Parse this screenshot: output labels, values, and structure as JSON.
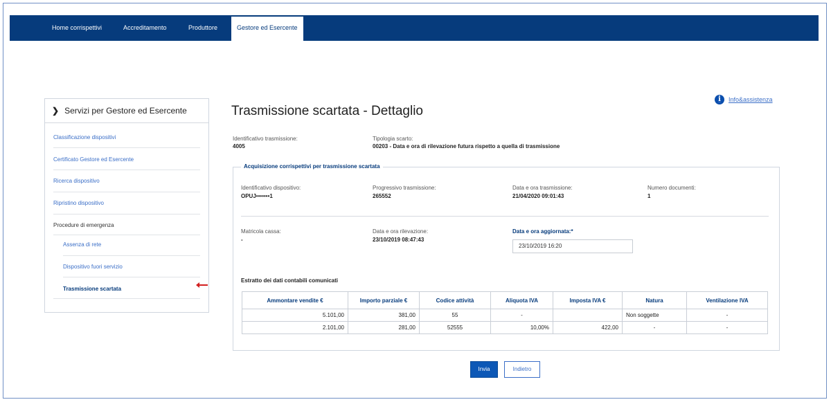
{
  "nav": {
    "items": [
      "Home corrispettivi",
      "Accreditamento",
      "Produttore",
      "Gestore ed Esercente"
    ],
    "active_index": 3
  },
  "info_link": "Info&assistenza",
  "sidebar": {
    "title": "Servizi per Gestore ed Esercente",
    "items": [
      "Classificazione dispositivi",
      "Certificato Gestore ed Esercente",
      "Ricerca dispositivo",
      "Ripristino dispositivo"
    ],
    "group_label": "Procedure di emergenza",
    "sub_items": [
      "Assenza di rete",
      "Dispositivo fuori servizio",
      "Trasmissione scartata"
    ]
  },
  "page_title": "Trasmissione scartata - Dettaglio",
  "header_fields": {
    "id_label": "Identificativo trasmissione:",
    "id_value": "4005",
    "tipo_label": "Tipologia scarto:",
    "tipo_value": "00203 - Data e ora di rilevazione futura rispetto a quella di trasmissione"
  },
  "section": {
    "legend": "Acquisizione corrispettivi per trasmissione scartata",
    "fields": [
      {
        "label": "Identificativo dispositivo:",
        "value": "OPUJ•••••••1"
      },
      {
        "label": "Progressivo trasmissione:",
        "value": "265552"
      },
      {
        "label": "Data e ora trasmissione:",
        "value": "21/04/2020 09:01:43"
      },
      {
        "label": "Numero documenti:",
        "value": "1"
      },
      {
        "label": "Matricola cassa:",
        "value": "-"
      },
      {
        "label": "Data e ora rilevazione:",
        "value": "23/10/2019 08:47:43"
      }
    ],
    "updated_label": "Data e ora aggiornata:*",
    "updated_value": "23/10/2019 16:20"
  },
  "table": {
    "caption": "Estratto dei dati contabili comunicati",
    "headers": [
      "Ammontare vendite €",
      "Importo parziale €",
      "Codice attività",
      "Aliquota IVA",
      "Imposta IVA €",
      "Natura",
      "Ventilazione IVA"
    ],
    "rows": [
      [
        "5.101,00",
        "381,00",
        "55",
        "-",
        "",
        "Non soggette",
        "-"
      ],
      [
        "2.101,00",
        "281,00",
        "52555",
        "10,00%",
        "422,00",
        "-",
        "-"
      ]
    ]
  },
  "buttons": {
    "submit": "Invia",
    "back": "Indietro"
  },
  "colors": {
    "nav_bg": "#063b7c",
    "link": "#3a6ec7",
    "primary": "#0d58b6",
    "arrow": "#d21f1f"
  }
}
